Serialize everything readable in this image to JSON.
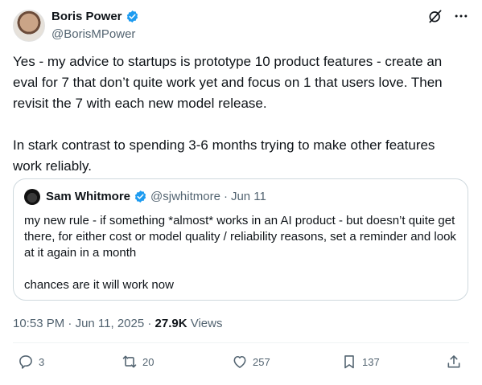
{
  "author": {
    "name": "Boris Power",
    "handle": "@BorisMPower"
  },
  "tweet": {
    "text": "Yes - my advice to startups is prototype 10 product features - create an eval for 7 that don’t quite work yet and focus on 1 that users love. Then revisit the 7 with each new model release.\n\nIn stark contrast to spending 3-6 months trying to make other features work reliably."
  },
  "quote": {
    "name": "Sam Whitmore",
    "handle": "@sjwhitmore",
    "dot": "·",
    "date": "Jun 11",
    "text": "my new rule - if something *almost* works in an AI product - but doesn’t quite get there, for either cost or model quality / reliability reasons, set a reminder and look at it again in a month\n\nchances are it will work now"
  },
  "meta": {
    "time": "10:53 PM",
    "sep1": " · ",
    "date": "Jun 11, 2025",
    "sep2": " · ",
    "views_count": "27.9K",
    "views_label": " Views"
  },
  "actions": {
    "replies": "3",
    "reposts": "20",
    "likes": "257",
    "bookmarks": "137"
  },
  "colors": {
    "text": "#0f1419",
    "secondary": "#536471",
    "verified": "#1d9bf0",
    "border": "#cfd9de"
  },
  "icons": [
    "verified-badge-icon",
    "grok-icon",
    "more-icon",
    "reply-icon",
    "repost-icon",
    "like-icon",
    "bookmark-icon",
    "share-icon"
  ]
}
